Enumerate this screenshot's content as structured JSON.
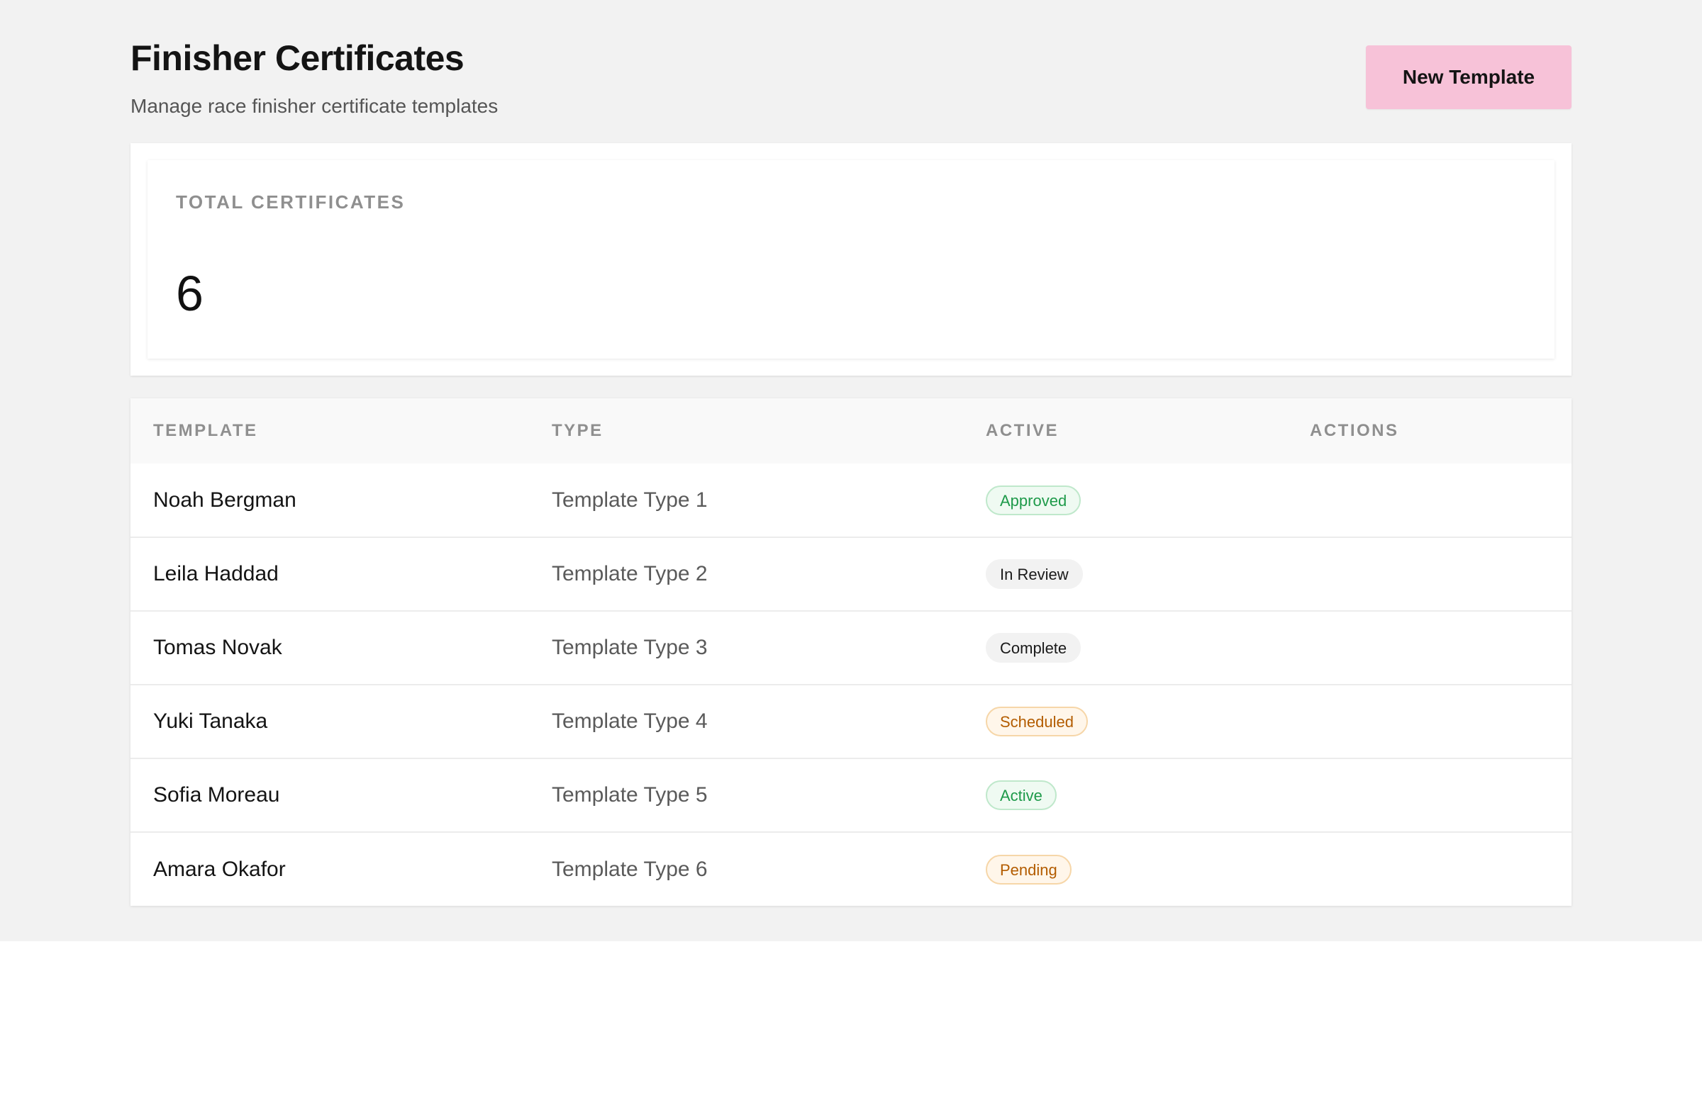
{
  "header": {
    "title": "Finisher Certificates",
    "subtitle": "Manage race finisher certificate templates",
    "new_button_label": "New Template"
  },
  "stats": {
    "total_label": "TOTAL CERTIFICATES",
    "total_value": "6"
  },
  "table": {
    "columns": [
      "TEMPLATE",
      "TYPE",
      "ACTIVE",
      "ACTIONS"
    ],
    "rows": [
      {
        "name": "Noah Bergman",
        "type": "Template Type 1",
        "status": "Approved",
        "status_tone": "green"
      },
      {
        "name": "Leila Haddad",
        "type": "Template Type 2",
        "status": "In Review",
        "status_tone": "gray"
      },
      {
        "name": "Tomas Novak",
        "type": "Template Type 3",
        "status": "Complete",
        "status_tone": "gray"
      },
      {
        "name": "Yuki Tanaka",
        "type": "Template Type 4",
        "status": "Scheduled",
        "status_tone": "orange"
      },
      {
        "name": "Sofia Moreau",
        "type": "Template Type 5",
        "status": "Active",
        "status_tone": "green"
      },
      {
        "name": "Amara Okafor",
        "type": "Template Type 6",
        "status": "Pending",
        "status_tone": "orange"
      }
    ]
  },
  "colors": {
    "background": "#f2f2f2",
    "primary_button": "#f7c2d8",
    "status_green": "#1e9a4a",
    "status_orange": "#b35c00"
  }
}
